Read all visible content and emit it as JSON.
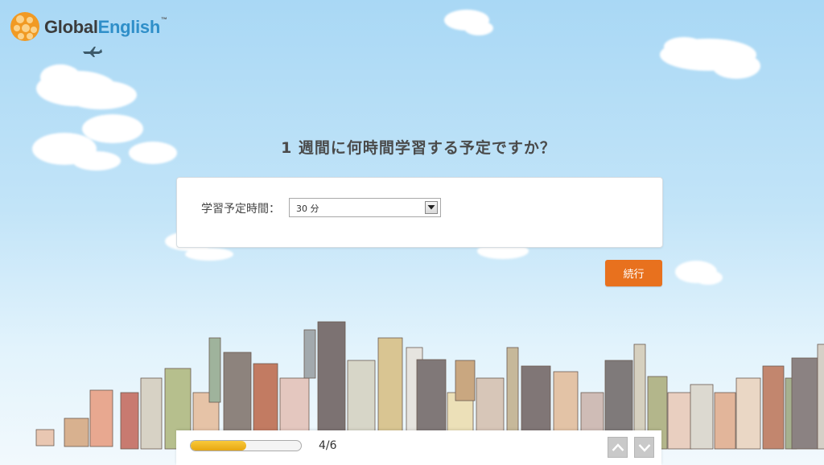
{
  "brand": {
    "part1": "Global",
    "part2": "English",
    "tm": "™",
    "colors": {
      "dark": "#3b3b3b",
      "blue": "#2f8fc9",
      "orange": "#f19a23"
    }
  },
  "question": "1 週間に何時間学習する予定ですか？",
  "form": {
    "label": "学習予定時間：",
    "select_value": "30 分"
  },
  "continue_label": "続行",
  "accent_color": "#e8711e",
  "progress": {
    "text": "4/6",
    "fraction": 0.5
  },
  "icons": {
    "logo": "globalenglish-logo-icon",
    "plane": "airplane-icon",
    "dropdown": "chevron-down-icon",
    "prev": "chevron-up-icon",
    "next": "chevron-down-icon"
  }
}
